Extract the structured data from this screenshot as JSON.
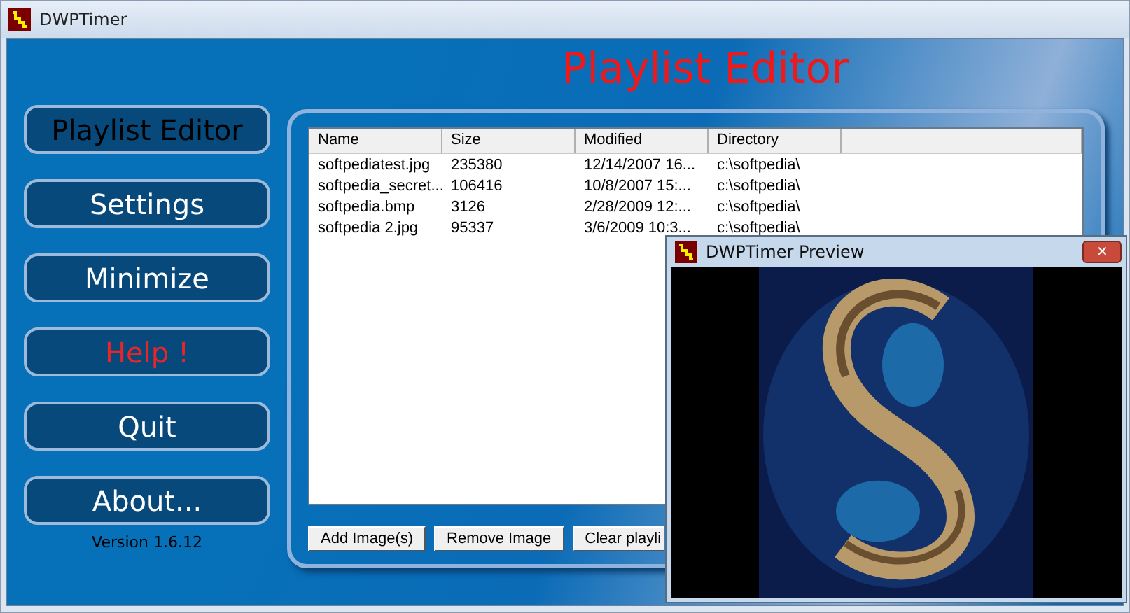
{
  "window": {
    "title": "DWPTimer"
  },
  "heading": "Playlist Editor",
  "sidebar": {
    "items": [
      {
        "label": "Playlist Editor",
        "selected": true,
        "kind": "normal"
      },
      {
        "label": "Settings",
        "selected": false,
        "kind": "normal"
      },
      {
        "label": "Minimize",
        "selected": false,
        "kind": "normal"
      },
      {
        "label": "Help !",
        "selected": false,
        "kind": "help"
      },
      {
        "label": "Quit",
        "selected": false,
        "kind": "normal"
      },
      {
        "label": "About...",
        "selected": false,
        "kind": "normal"
      }
    ],
    "version": "Version 1.6.12"
  },
  "table": {
    "columns": [
      "Name",
      "Size",
      "Modified",
      "Directory"
    ],
    "rows": [
      [
        "softpediatest.jpg",
        "235380",
        "12/14/2007 16...",
        "c:\\softpedia\\"
      ],
      [
        "softpedia_secret...",
        "106416",
        "10/8/2007 15:...",
        "c:\\softpedia\\"
      ],
      [
        "softpedia.bmp",
        "3126",
        "2/28/2009 12:...",
        "c:\\softpedia\\"
      ],
      [
        "softpedia 2.jpg",
        "95337",
        "3/6/2009 10:3...",
        "c:\\softpedia\\"
      ]
    ]
  },
  "buttons": [
    "Add Image(s)",
    "Remove Image",
    "Clear playli"
  ],
  "preview": {
    "title": "DWPTimer Preview",
    "close": "✕"
  }
}
